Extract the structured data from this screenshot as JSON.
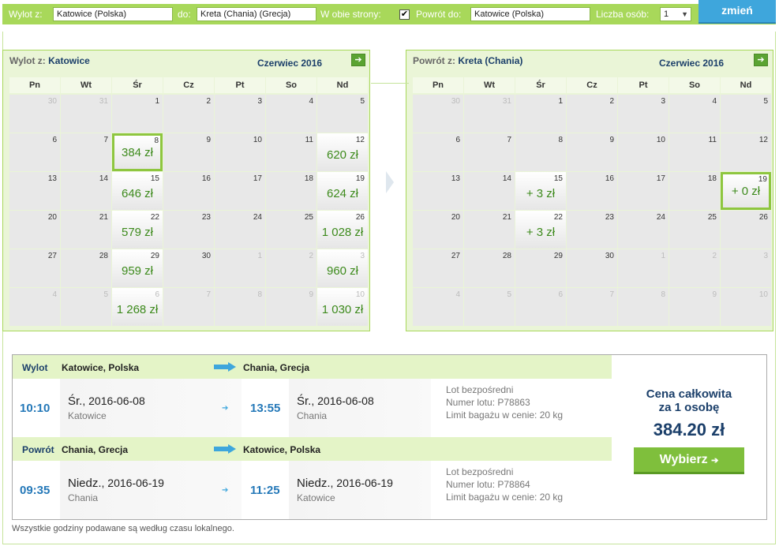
{
  "search": {
    "from_label": "Wylot z:",
    "from_value": "Katowice (Polska)",
    "to_label": "do:",
    "to_value": "Kreta (Chania) (Grecja)",
    "round_label": "W obie strony:",
    "round_checked": "✔",
    "return_label": "Powrót do:",
    "return_value": "Katowice (Polska)",
    "persons_label": "Liczba osób:",
    "persons_value": "1",
    "change_label": "zmień"
  },
  "weekdays": [
    "Pn",
    "Wt",
    "Śr",
    "Cz",
    "Pt",
    "So",
    "Nd"
  ],
  "outbound_cal": {
    "label": "Wylot z:",
    "city": "Katowice",
    "month": "Czerwiec 2016",
    "cells": [
      {
        "d": "30",
        "o": true
      },
      {
        "d": "31",
        "o": true
      },
      {
        "d": "1"
      },
      {
        "d": "2"
      },
      {
        "d": "3"
      },
      {
        "d": "4"
      },
      {
        "d": "5"
      },
      {
        "d": "6"
      },
      {
        "d": "7"
      },
      {
        "d": "8",
        "p": "384 zł",
        "s": true
      },
      {
        "d": "9"
      },
      {
        "d": "10"
      },
      {
        "d": "11"
      },
      {
        "d": "12",
        "p": "620 zł"
      },
      {
        "d": "13"
      },
      {
        "d": "14"
      },
      {
        "d": "15",
        "p": "646 zł"
      },
      {
        "d": "16"
      },
      {
        "d": "17"
      },
      {
        "d": "18"
      },
      {
        "d": "19",
        "p": "624 zł"
      },
      {
        "d": "20"
      },
      {
        "d": "21"
      },
      {
        "d": "22",
        "p": "579 zł"
      },
      {
        "d": "23"
      },
      {
        "d": "24"
      },
      {
        "d": "25"
      },
      {
        "d": "26",
        "p": "1 028 zł"
      },
      {
        "d": "27"
      },
      {
        "d": "28"
      },
      {
        "d": "29",
        "p": "959 zł"
      },
      {
        "d": "30"
      },
      {
        "d": "1",
        "o": true
      },
      {
        "d": "2",
        "o": true
      },
      {
        "d": "3",
        "o": true,
        "p": "960 zł"
      },
      {
        "d": "4",
        "o": true
      },
      {
        "d": "5",
        "o": true
      },
      {
        "d": "6",
        "o": true,
        "p": "1 268 zł"
      },
      {
        "d": "7",
        "o": true
      },
      {
        "d": "8",
        "o": true
      },
      {
        "d": "9",
        "o": true
      },
      {
        "d": "10",
        "o": true,
        "p": "1 030 zł"
      }
    ]
  },
  "return_cal": {
    "label": "Powrót z:",
    "city": "Kreta (Chania)",
    "month": "Czerwiec 2016",
    "cells": [
      {
        "d": "30",
        "o": true
      },
      {
        "d": "31",
        "o": true
      },
      {
        "d": "1"
      },
      {
        "d": "2"
      },
      {
        "d": "3"
      },
      {
        "d": "4"
      },
      {
        "d": "5"
      },
      {
        "d": "6"
      },
      {
        "d": "7"
      },
      {
        "d": "8"
      },
      {
        "d": "9"
      },
      {
        "d": "10"
      },
      {
        "d": "11"
      },
      {
        "d": "12"
      },
      {
        "d": "13"
      },
      {
        "d": "14"
      },
      {
        "d": "15",
        "p": "+ 3 zł"
      },
      {
        "d": "16"
      },
      {
        "d": "17"
      },
      {
        "d": "18"
      },
      {
        "d": "19",
        "p": "+ 0 zł",
        "s": true
      },
      {
        "d": "20"
      },
      {
        "d": "21"
      },
      {
        "d": "22",
        "p": "+ 3 zł"
      },
      {
        "d": "23"
      },
      {
        "d": "24"
      },
      {
        "d": "25"
      },
      {
        "d": "26"
      },
      {
        "d": "27"
      },
      {
        "d": "28"
      },
      {
        "d": "29"
      },
      {
        "d": "30"
      },
      {
        "d": "1",
        "o": true
      },
      {
        "d": "2",
        "o": true
      },
      {
        "d": "3",
        "o": true
      },
      {
        "d": "4",
        "o": true
      },
      {
        "d": "5",
        "o": true
      },
      {
        "d": "6",
        "o": true
      },
      {
        "d": "7",
        "o": true
      },
      {
        "d": "8",
        "o": true
      },
      {
        "d": "9",
        "o": true
      },
      {
        "d": "10",
        "o": true
      }
    ]
  },
  "outbound": {
    "label": "Wylot",
    "from": "Katowice, Polska",
    "to": "Chania, Grecja",
    "dep_time": "10:10",
    "dep_day": "Śr.",
    "dep_date": ", 2016-06-08",
    "dep_city": "Katowice",
    "arr_time": "13:55",
    "arr_day": "Śr.",
    "arr_date": ", 2016-06-08",
    "arr_city": "Chania",
    "info1": "Lot bezpośredni",
    "info2": "Numer lotu: P78863",
    "info3": "Limit bagażu w cenie: 20 kg"
  },
  "return": {
    "label": "Powrót",
    "from": "Chania, Grecja",
    "to": "Katowice, Polska",
    "dep_time": "09:35",
    "dep_day": "Niedz.",
    "dep_date": ", 2016-06-19",
    "dep_city": "Chania",
    "arr_time": "11:25",
    "arr_day": "Niedz.",
    "arr_date": ", 2016-06-19",
    "arr_city": "Katowice",
    "info1": "Lot bezpośredni",
    "info2": "Numer lotu: P78864",
    "info3": "Limit bagażu w cenie: 20 kg"
  },
  "price": {
    "line1": "Cena całkowita",
    "line2": "za 1 osobę",
    "value": "384.20 zł",
    "button": "Wybierz",
    "button_icon": "➔"
  },
  "footnote": "Wszystkie godziny podawane są według czasu lokalnego.",
  "icons": {
    "next": "➔",
    "arrow_small": "➔"
  }
}
